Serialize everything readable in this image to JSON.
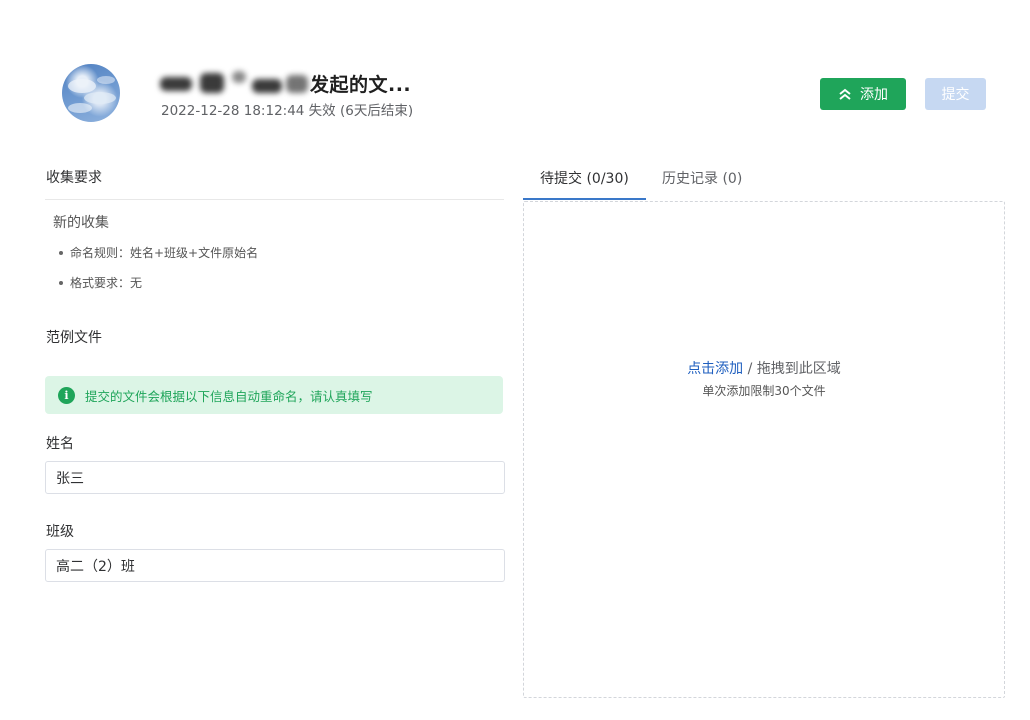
{
  "header": {
    "title_suffix": "发起的文...",
    "subtitle": "2022-12-28 18:12:44 失效 (6天后结束)",
    "add_button_label": "添加",
    "submit_button_label": "提交"
  },
  "requirements": {
    "section_title": "收集要求",
    "head": "新的收集",
    "rules": [
      "命名规则：姓名+班级+文件原始名",
      "格式要求：无"
    ]
  },
  "example": {
    "section_title": "范例文件"
  },
  "alert": {
    "text": "提交的文件会根据以下信息自动重命名，请认真填写"
  },
  "form": {
    "fields": [
      {
        "label": "姓名",
        "value": "张三"
      },
      {
        "label": "班级",
        "value": "高二（2）班"
      }
    ]
  },
  "tabs": [
    {
      "label": "待提交 (0/30)",
      "active": true
    },
    {
      "label": "历史记录 (0)",
      "active": false
    }
  ],
  "dropzone": {
    "link_text": "点击添加",
    "separator": " / ",
    "rest_text": "拖拽到此区域",
    "hint": "单次添加限制30个文件"
  },
  "colors": {
    "primary_green": "#1fa55a",
    "disabled_blue": "#c6d8f2",
    "link_blue": "#1f5fbf",
    "alert_bg": "#dcf5e6"
  }
}
